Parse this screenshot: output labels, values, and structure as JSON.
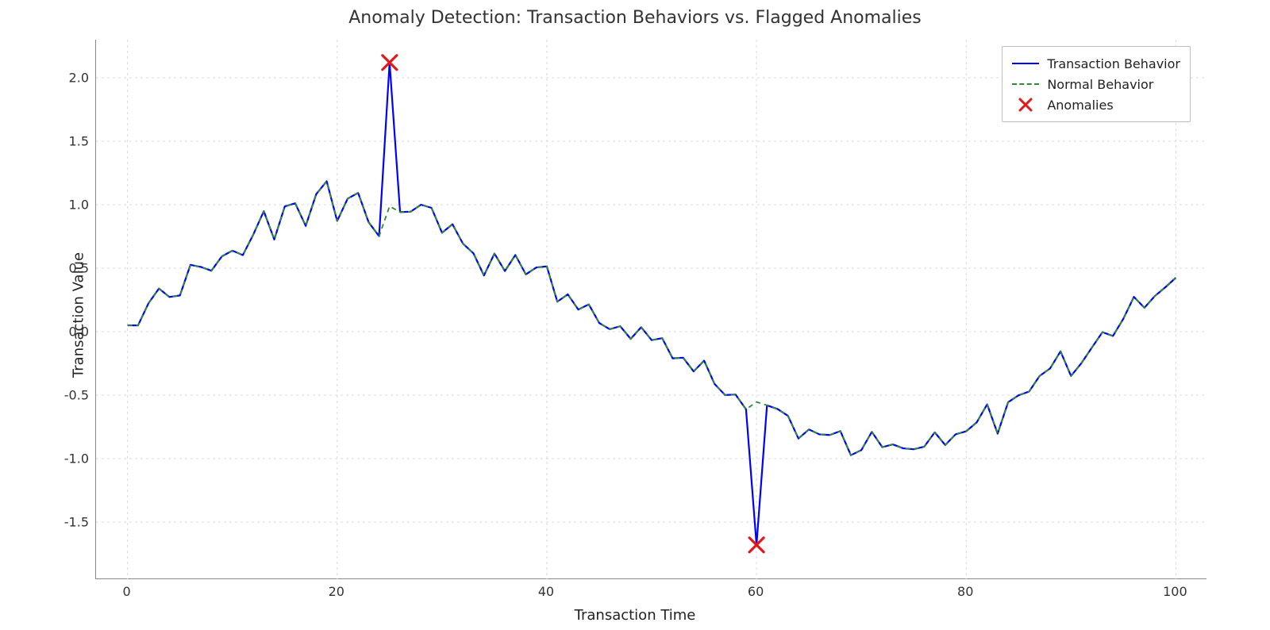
{
  "chart_data": {
    "type": "line",
    "title": "Anomaly Detection: Transaction Behaviors vs. Flagged Anomalies",
    "xlabel": "Transaction Time",
    "ylabel": "Transaction Value",
    "xlim": [
      -3,
      103
    ],
    "ylim": [
      -1.95,
      2.3
    ],
    "x_ticks": [
      0,
      20,
      40,
      60,
      80,
      100
    ],
    "y_ticks": [
      -1.5,
      -1.0,
      -0.5,
      0.0,
      0.5,
      1.0,
      1.5,
      2.0
    ],
    "legend": {
      "entries": [
        {
          "label": "Transaction Behavior",
          "style": "solid-blue"
        },
        {
          "label": "Normal Behavior",
          "style": "dashed-green"
        },
        {
          "label": "Anomalies",
          "style": "red-x"
        }
      ],
      "position": "upper-right"
    },
    "series": [
      {
        "name": "Normal Behavior",
        "style": "dashed-green",
        "x": [
          0,
          1,
          2,
          3,
          4,
          5,
          6,
          7,
          8,
          9,
          10,
          11,
          12,
          13,
          14,
          15,
          16,
          17,
          18,
          19,
          20,
          21,
          22,
          23,
          24,
          25,
          26,
          27,
          28,
          29,
          30,
          31,
          32,
          33,
          34,
          35,
          36,
          37,
          38,
          39,
          40,
          41,
          42,
          43,
          44,
          45,
          46,
          47,
          48,
          49,
          50,
          51,
          52,
          53,
          54,
          55,
          56,
          57,
          58,
          59,
          60,
          61,
          62,
          63,
          64,
          65,
          66,
          67,
          68,
          69,
          70,
          71,
          72,
          73,
          74,
          75,
          76,
          77,
          78,
          79,
          80,
          81,
          82,
          83,
          84,
          85,
          86,
          87,
          88,
          89,
          90,
          91,
          92,
          93,
          94,
          95,
          96,
          97,
          98,
          99,
          100
        ],
        "y": [
          0.05,
          0.049,
          0.223,
          0.34,
          0.273,
          0.285,
          0.526,
          0.51,
          0.48,
          0.593,
          0.638,
          0.603,
          0.765,
          0.949,
          0.726,
          0.986,
          1.011,
          0.833,
          1.083,
          1.185,
          0.872,
          1.048,
          1.093,
          0.862,
          0.752,
          0.988,
          0.942,
          0.945,
          1.0,
          0.975,
          0.779,
          0.846,
          0.693,
          0.617,
          0.442,
          0.615,
          0.478,
          0.604,
          0.451,
          0.506,
          0.514,
          0.236,
          0.294,
          0.174,
          0.215,
          0.068,
          0.019,
          0.043,
          -0.057,
          0.035,
          -0.067,
          -0.051,
          -0.21,
          -0.205,
          -0.313,
          -0.228,
          -0.412,
          -0.499,
          -0.495,
          -0.612,
          -0.554,
          -0.58,
          -0.609,
          -0.663,
          -0.842,
          -0.77,
          -0.809,
          -0.814,
          -0.783,
          -0.973,
          -0.933,
          -0.789,
          -0.91,
          -0.888,
          -0.919,
          -0.926,
          -0.906,
          -0.793,
          -0.893,
          -0.808,
          -0.785,
          -0.715,
          -0.572,
          -0.803,
          -0.556,
          -0.501,
          -0.472,
          -0.349,
          -0.29,
          -0.155,
          -0.349,
          -0.247,
          -0.124,
          -0.004,
          -0.034,
          0.103,
          0.274,
          0.188,
          0.281,
          0.35,
          0.425
        ]
      },
      {
        "name": "Transaction Behavior",
        "style": "solid-blue",
        "x": [
          0,
          1,
          2,
          3,
          4,
          5,
          6,
          7,
          8,
          9,
          10,
          11,
          12,
          13,
          14,
          15,
          16,
          17,
          18,
          19,
          20,
          21,
          22,
          23,
          24,
          25,
          26,
          27,
          28,
          29,
          30,
          31,
          32,
          33,
          34,
          35,
          36,
          37,
          38,
          39,
          40,
          41,
          42,
          43,
          44,
          45,
          46,
          47,
          48,
          49,
          50,
          51,
          52,
          53,
          54,
          55,
          56,
          57,
          58,
          59,
          60,
          61,
          62,
          63,
          64,
          65,
          66,
          67,
          68,
          69,
          70,
          71,
          72,
          73,
          74,
          75,
          76,
          77,
          78,
          79,
          80,
          81,
          82,
          83,
          84,
          85,
          86,
          87,
          88,
          89,
          90,
          91,
          92,
          93,
          94,
          95,
          96,
          97,
          98,
          99,
          100
        ],
        "y": [
          0.05,
          0.049,
          0.223,
          0.34,
          0.273,
          0.285,
          0.526,
          0.51,
          0.48,
          0.593,
          0.638,
          0.603,
          0.765,
          0.949,
          0.726,
          0.986,
          1.011,
          0.833,
          1.083,
          1.185,
          0.872,
          1.048,
          1.093,
          0.862,
          0.752,
          2.12,
          0.942,
          0.945,
          1.0,
          0.975,
          0.779,
          0.846,
          0.693,
          0.617,
          0.442,
          0.615,
          0.478,
          0.604,
          0.451,
          0.506,
          0.514,
          0.236,
          0.294,
          0.174,
          0.215,
          0.068,
          0.019,
          0.043,
          -0.057,
          0.035,
          -0.067,
          -0.051,
          -0.21,
          -0.205,
          -0.313,
          -0.228,
          -0.412,
          -0.499,
          -0.495,
          -0.612,
          -1.68,
          -0.58,
          -0.609,
          -0.663,
          -0.842,
          -0.77,
          -0.809,
          -0.814,
          -0.783,
          -0.973,
          -0.933,
          -0.789,
          -0.91,
          -0.888,
          -0.919,
          -0.926,
          -0.906,
          -0.793,
          -0.893,
          -0.808,
          -0.785,
          -0.715,
          -0.572,
          -0.803,
          -0.556,
          -0.501,
          -0.472,
          -0.349,
          -0.29,
          -0.155,
          -0.349,
          -0.247,
          -0.124,
          -0.004,
          -0.034,
          0.103,
          0.274,
          0.188,
          0.281,
          0.35,
          0.425
        ]
      }
    ],
    "anomalies": {
      "name": "Anomalies",
      "style": "red-x",
      "points": [
        {
          "x": 25,
          "y": 2.12
        },
        {
          "x": 60,
          "y": -1.68
        }
      ]
    }
  },
  "colors": {
    "transaction": "#0000ff",
    "normal": "#2f8b2f",
    "anomaly": "#e11919",
    "grid": "#d9d9d9",
    "axis": "#888888"
  }
}
